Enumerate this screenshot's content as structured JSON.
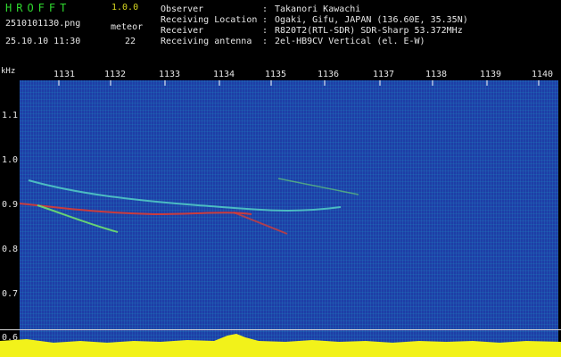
{
  "header": {
    "app_title": "HROFFT",
    "version": "1.0.0",
    "filename": "2510101130.png",
    "category": "meteor",
    "datetime": "25.10.10 11:30",
    "count": "22",
    "info": [
      {
        "label": "Observer",
        "value": "Takanori Kawachi"
      },
      {
        "label": "Receiving Location",
        "value": "Ogaki, Gifu, JAPAN (136.60E, 35.35N)"
      },
      {
        "label": "Receiver",
        "value": "R820T2(RTL-SDR) SDR-Sharp 53.372MHz"
      },
      {
        "label": "Receiving antenna",
        "value": "2el-HB9CV Vertical (el. E-W)"
      }
    ]
  },
  "y_axis": {
    "unit": "kHz",
    "ticks": [
      "1.1",
      "1.0",
      "0.9",
      "0.8",
      "0.7",
      "0.6"
    ]
  },
  "x_axis": {
    "ticks": [
      "1131",
      "1132",
      "1133",
      "1134",
      "1135",
      "1136",
      "1137",
      "1138",
      "1139",
      "1140"
    ]
  },
  "colors": {
    "background": "#1e3ea6",
    "trace_red": "#e83a2a",
    "trace_green": "#6fe06f",
    "level_yellow": "#f2f21a"
  }
}
